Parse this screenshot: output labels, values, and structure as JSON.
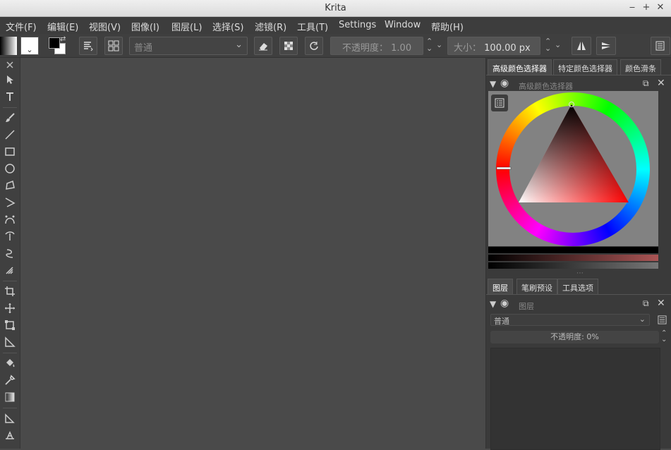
{
  "window": {
    "title": "Krita"
  },
  "menu": [
    "文件(F)",
    "编辑(E)",
    "视图(V)",
    "图像(I)",
    "图层(L)",
    "选择(S)",
    "滤镜(R)",
    "工具(T)",
    "Settings",
    "Window",
    "帮助(H)"
  ],
  "toolbar": {
    "blend_mode": "普通",
    "opacity_label": "不透明度：",
    "opacity_value": "1.00",
    "size_label": "大小：",
    "size_value": "100.00 px"
  },
  "dock": {
    "tabs_top": [
      "高级颜色选择器",
      "特定颜色选择器",
      "颜色滑条"
    ],
    "color_panel_title": "高级颜色选择器",
    "tabs_bottom": [
      "图层",
      "笔刷预设",
      "工具选项"
    ],
    "layers_panel_title": "图层",
    "layers_blend_mode": "普通",
    "layers_opacity": "不透明度: 0%"
  },
  "colors": {
    "foreground": "#000000",
    "background": "#ffffff",
    "selected_hue": "#ff0000"
  },
  "icons": [
    "close-icon",
    "select-icon",
    "text-icon",
    "brush-icon",
    "line-icon",
    "rectangle-icon",
    "ellipse-icon",
    "polygon-icon",
    "polyline-icon",
    "bezier-icon",
    "freehand-path-icon",
    "dynamic-brush-icon",
    "multibrush-icon",
    "crop-icon",
    "move-icon",
    "transform-icon",
    "perspective-icon",
    "fill-icon",
    "color-picker-icon",
    "gradient-icon",
    "measure-icon",
    "assistant-icon"
  ]
}
